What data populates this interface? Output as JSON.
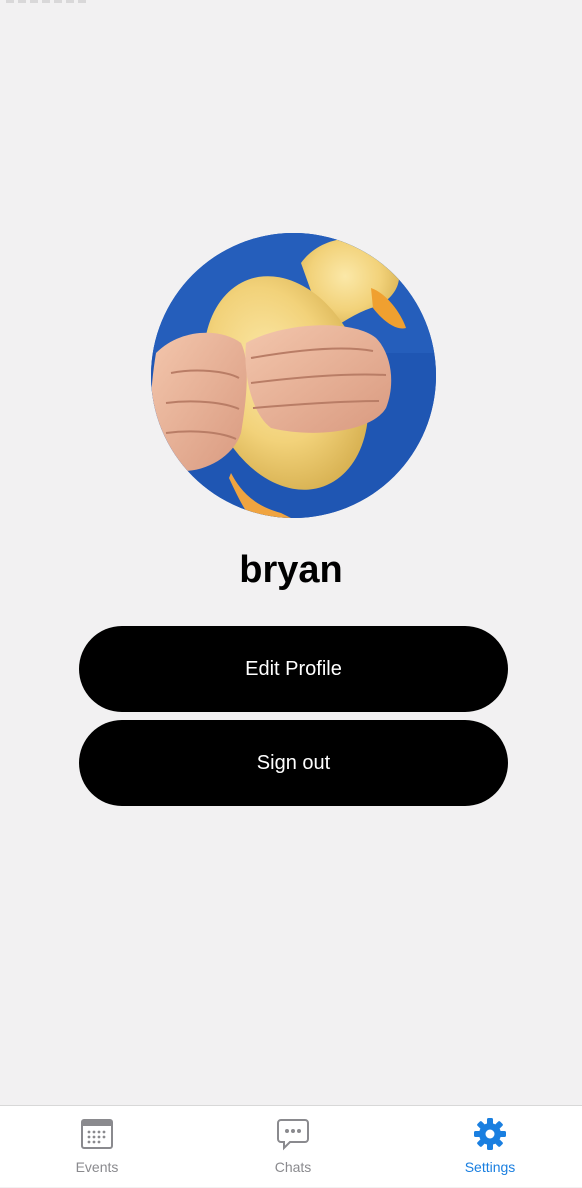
{
  "profile": {
    "username": "bryan",
    "avatar_icon": "duckling-photo"
  },
  "actions": {
    "edit_profile_label": "Edit Profile",
    "sign_out_label": "Sign out"
  },
  "tabbar": {
    "active": "settings",
    "accent_color": "#1a7fe0",
    "inactive_color": "#8a8a8e",
    "tabs": [
      {
        "id": "events",
        "label": "Events",
        "icon": "calendar-icon"
      },
      {
        "id": "chats",
        "label": "Chats",
        "icon": "chat-bubble-icon"
      },
      {
        "id": "settings",
        "label": "Settings",
        "icon": "gear-icon"
      }
    ]
  }
}
